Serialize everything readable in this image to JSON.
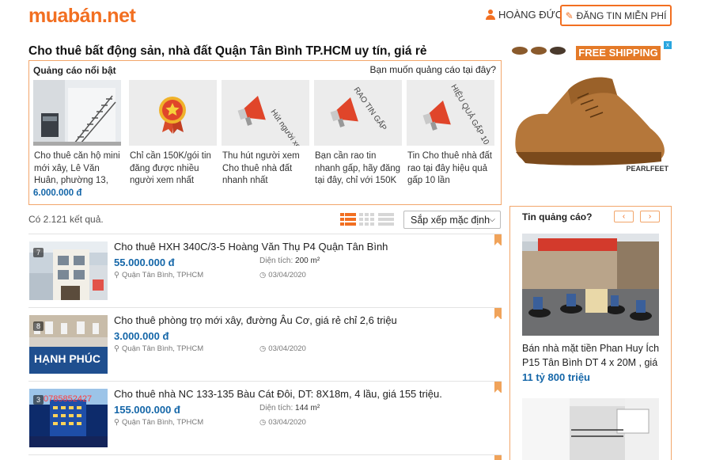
{
  "header": {
    "logo_main": "muabán",
    "logo_tld": ".net",
    "user_name": "HOÀNG ĐỨC",
    "post_button": "ĐĂNG TIN MIỄN PHÍ"
  },
  "page_title": "Cho thuê bất động sản, nhà đất Quận Tân Bình TP.HCM uy tín, giá rẻ",
  "featured": {
    "heading": "Quảng cáo nổi bật",
    "advertise_link": "Bạn muốn quảng cáo tại đây?",
    "items": [
      {
        "text": "Cho thuê căn hộ mini mới xây, Lê Văn Huân, phường 13,",
        "price": "6.000.000 đ"
      },
      {
        "text": "Chỉ cần 150K/gói tin đăng được nhiều người xem nhất",
        "price": ""
      },
      {
        "text": "Thu hút người xem Cho thuê nhà đất nhanh nhất",
        "price": ""
      },
      {
        "text": "Bạn cần rao tin nhanh gấp, hãy đăng tại đây, chỉ với 150K",
        "price": ""
      },
      {
        "text": "Tin Cho thuê nhà đất rao tại đây hiệu quả gấp 10 lần",
        "price": ""
      }
    ],
    "megaphone_labels": [
      "Hút người xem",
      "RAO TIN GẤP",
      "HIỆU QUẢ GẤP 10"
    ]
  },
  "shoe_ad": {
    "banner": "FREE SHIPPING",
    "brand": "PEARLFEET",
    "badge": "x"
  },
  "results": {
    "count_text": "Có 2.121 kết quả.",
    "sort_label": "Sắp xếp mặc định"
  },
  "listings": [
    {
      "title": "Cho thuê HXH 340C/3-5 Hoàng Văn Thụ P4 Quận Tân Bình",
      "price": "55.000.000 đ",
      "area_label": "Diện tích:",
      "area": "200 m²",
      "location": "Quận Tân Bình, TPHCM",
      "date": "03/04/2020",
      "photo_count": "7",
      "sign_text": ""
    },
    {
      "title": "Cho thuê phòng trọ mới xây, đường Âu Cơ, giá rẻ chỉ 2,6 triệu",
      "price": "3.000.000 đ",
      "area_label": "",
      "area": "",
      "location": "Quận Tân Bình, TPHCM",
      "date": "03/04/2020",
      "photo_count": "8",
      "sign_text": "HẠNH PHÚC"
    },
    {
      "title": "Cho thuê nhà NC 133-135 Bàu Cát Đôi, DT: 8X18m, 4 lầu, giá 155 triệu.",
      "price": "155.000.000 đ",
      "area_label": "Diện tích:",
      "area": "144 m²",
      "location": "Quận Tân Bình, TPHCM",
      "date": "03/04/2020",
      "photo_count": "3",
      "sign_text": "0785852427"
    }
  ],
  "sponsored": {
    "heading": "Tin quảng cáo?",
    "prev": "‹",
    "next": "›",
    "title": "Bán nhà mặt tiền Phan Huy Ích P15 Tân Bình DT 4 x 20M , giá",
    "price": "11 tỷ 800 triệu"
  },
  "colors": {
    "accent": "#f26f21",
    "price_blue": "#1466a8",
    "border_orange": "#f2a66b"
  }
}
